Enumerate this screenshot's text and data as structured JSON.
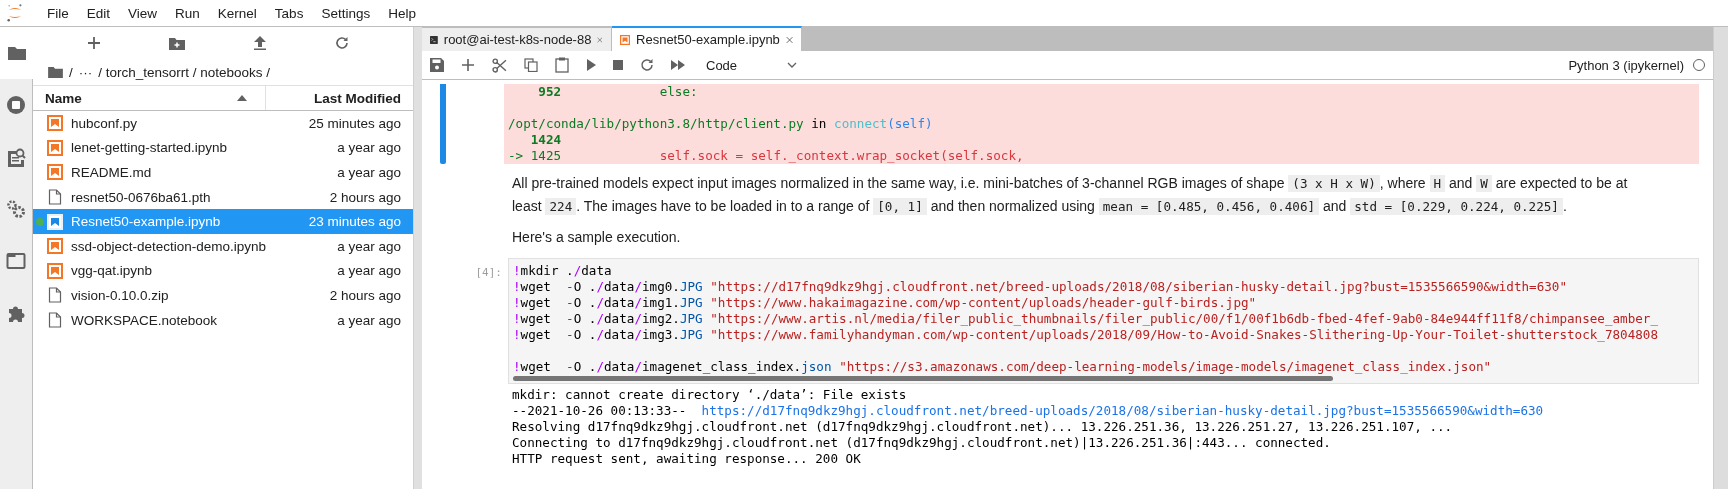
{
  "menu": [
    "File",
    "Edit",
    "View",
    "Run",
    "Kernel",
    "Tabs",
    "Settings",
    "Help"
  ],
  "file_browser": {
    "breadcrumb": [
      "/",
      "···",
      "/ torch_tensorrt / notebooks /"
    ],
    "columns": [
      {
        "label": "Name",
        "sorted": true
      },
      {
        "label": "Last Modified",
        "sorted": false
      }
    ],
    "files": [
      {
        "name": "hubconf.py",
        "modified": "25 minutes ago",
        "kind": "notebook",
        "selected": false,
        "running": false
      },
      {
        "name": "lenet-getting-started.ipynb",
        "modified": "a year ago",
        "kind": "notebook",
        "selected": false,
        "running": false
      },
      {
        "name": "README.md",
        "modified": "a year ago",
        "kind": "notebook",
        "selected": false,
        "running": false
      },
      {
        "name": "resnet50-0676ba61.pth",
        "modified": "2 hours ago",
        "kind": "file",
        "selected": false,
        "running": false
      },
      {
        "name": "Resnet50-example.ipynb",
        "modified": "23 minutes ago",
        "kind": "notebook",
        "selected": true,
        "running": true
      },
      {
        "name": "ssd-object-detection-demo.ipynb",
        "modified": "a year ago",
        "kind": "notebook",
        "selected": false,
        "running": false
      },
      {
        "name": "vgg-qat.ipynb",
        "modified": "a year ago",
        "kind": "notebook",
        "selected": false,
        "running": false
      },
      {
        "name": "vision-0.10.0.zip",
        "modified": "2 hours ago",
        "kind": "file",
        "selected": false,
        "running": false
      },
      {
        "name": "WORKSPACE.notebook",
        "modified": "a year ago",
        "kind": "file",
        "selected": false,
        "running": false
      }
    ]
  },
  "tabs": [
    {
      "label": "root@ai-test-k8s-node-88",
      "kind": "terminal",
      "selected": false
    },
    {
      "label": "Resnet50-example.ipynb",
      "kind": "notebook",
      "selected": true
    }
  ],
  "toolbar": {
    "cell_type": "Code",
    "kernel": "Python 3 (ipykernel)"
  },
  "traceback": [
    [
      [
        {
          "t": "    952",
          "kind": "num"
        },
        {
          "t": "             else:",
          "kind": "green"
        }
      ]
    ],
    [
      [
        {
          "t": "/opt/conda/lib/python3.8/http/client.py",
          "kind": "green"
        },
        {
          "t": " in ",
          "kind": "text"
        },
        {
          "t": "connect",
          "kind": "cyan"
        },
        {
          "t": "(self)",
          "kind": "blue"
        }
      ],
      [
        {
          "t": "   1424",
          "kind": "num"
        }
      ],
      [
        {
          "t": "-> 1425",
          "kind": "green"
        },
        {
          "t": "             self.sock = self._context.wrap_socket(self.sock,",
          "kind": "red"
        }
      ]
    ]
  ],
  "markdown": [
    [
      {
        "t": "All pre-trained models expect input images normalized in the same way, i.e. mini-batches of 3-channel RGB images of shape ",
        "code": false
      },
      {
        "t": "(3 x H x W)",
        "code": true
      },
      {
        "t": ", where ",
        "code": false
      },
      {
        "t": "H",
        "code": true
      },
      {
        "t": " and ",
        "code": false
      },
      {
        "t": "W",
        "code": true
      },
      {
        "t": " are expected to be at least ",
        "code": false
      },
      {
        "t": "224",
        "code": true
      },
      {
        "t": ". The images have to be loaded in to a range of ",
        "code": false
      },
      {
        "t": "[0, 1]",
        "code": true
      },
      {
        "t": " and then normalized using ",
        "code": false
      },
      {
        "t": "mean = [0.485, 0.456, 0.406]",
        "code": true
      },
      {
        "t": " and ",
        "code": false
      },
      {
        "t": "std = [0.229, 0.224, 0.225]",
        "code": true
      },
      {
        "t": ".",
        "code": false
      }
    ],
    [
      {
        "t": "Here's a sample execution.",
        "code": false
      }
    ]
  ],
  "code_cell": {
    "prompt": "[4]:",
    "blocks": [
      [
        [
          {
            "t": "!",
            "kind": "magic"
          },
          {
            "t": "mkdir .",
            "kind": "text"
          },
          {
            "t": "/",
            "kind": "op"
          },
          {
            "t": "data",
            "kind": "text"
          }
        ],
        [
          {
            "t": "!",
            "kind": "magic"
          },
          {
            "t": "wget  ",
            "kind": "text"
          },
          {
            "t": "-",
            "kind": "op"
          },
          {
            "t": "O .",
            "kind": "text"
          },
          {
            "t": "/",
            "kind": "op"
          },
          {
            "t": "data",
            "kind": "text"
          },
          {
            "t": "/",
            "kind": "op"
          },
          {
            "t": "img0.",
            "kind": "text"
          },
          {
            "t": "JPG",
            "kind": "attr"
          },
          {
            "t": " \"https://d17fnq9dkz9hgj.cloudfront.net/breed-uploads/2018/08/siberian-husky-detail.jpg?bust=1535566590&width=630\"",
            "kind": "str"
          }
        ],
        [
          {
            "t": "!",
            "kind": "magic"
          },
          {
            "t": "wget  ",
            "kind": "text"
          },
          {
            "t": "-",
            "kind": "op"
          },
          {
            "t": "O .",
            "kind": "text"
          },
          {
            "t": "/",
            "kind": "op"
          },
          {
            "t": "data",
            "kind": "text"
          },
          {
            "t": "/",
            "kind": "op"
          },
          {
            "t": "img1.",
            "kind": "text"
          },
          {
            "t": "JPG",
            "kind": "attr"
          },
          {
            "t": " \"https://www.hakaimagazine.com/wp-content/uploads/header-gulf-birds.jpg\"",
            "kind": "str"
          }
        ],
        [
          {
            "t": "!",
            "kind": "magic"
          },
          {
            "t": "wget  ",
            "kind": "text"
          },
          {
            "t": "-",
            "kind": "op"
          },
          {
            "t": "O .",
            "kind": "text"
          },
          {
            "t": "/",
            "kind": "op"
          },
          {
            "t": "data",
            "kind": "text"
          },
          {
            "t": "/",
            "kind": "op"
          },
          {
            "t": "img2.",
            "kind": "text"
          },
          {
            "t": "JPG",
            "kind": "attr"
          },
          {
            "t": " \"https://www.artis.nl/media/filer_public_thumbnails/filer_public/00/f1/00f1b6db-fbed-4fef-9ab0-84e944ff11f8/chimpansee_amber_",
            "kind": "str"
          }
        ],
        [
          {
            "t": "!",
            "kind": "magic"
          },
          {
            "t": "wget  ",
            "kind": "text"
          },
          {
            "t": "-",
            "kind": "op"
          },
          {
            "t": "O .",
            "kind": "text"
          },
          {
            "t": "/",
            "kind": "op"
          },
          {
            "t": "data",
            "kind": "text"
          },
          {
            "t": "/",
            "kind": "op"
          },
          {
            "t": "img3.",
            "kind": "text"
          },
          {
            "t": "JPG",
            "kind": "attr"
          },
          {
            "t": " \"https://www.familyhandyman.com/wp-content/uploads/2018/09/How-to-Avoid-Snakes-Slithering-Up-Your-Toilet-shutterstock_7804808",
            "kind": "str"
          }
        ]
      ],
      [
        [
          {
            "t": "!",
            "kind": "magic"
          },
          {
            "t": "wget  ",
            "kind": "text"
          },
          {
            "t": "-",
            "kind": "op"
          },
          {
            "t": "O .",
            "kind": "text"
          },
          {
            "t": "/",
            "kind": "op"
          },
          {
            "t": "data",
            "kind": "text"
          },
          {
            "t": "/",
            "kind": "op"
          },
          {
            "t": "imagenet_class_index.",
            "kind": "text"
          },
          {
            "t": "json",
            "kind": "attr"
          },
          {
            "t": " \"https://s3.amazonaws.com/deep-learning-models/image-models/imagenet_class_index.json\"",
            "kind": "str"
          }
        ]
      ]
    ]
  },
  "output": [
    [
      {
        "t": "mkdir: cannot create directory ‘./data’: File exists",
        "kind": "text"
      }
    ],
    [
      {
        "t": "--2021-10-26 00:13:33--  ",
        "kind": "text"
      },
      {
        "t": "https://d17fnq9dkz9hgj.cloudfront.net/breed-uploads/2018/08/siberian-husky-detail.jpg?bust=1535566590&width=630",
        "kind": "link"
      }
    ],
    [
      {
        "t": "Resolving d17fnq9dkz9hgj.cloudfront.net (d17fnq9dkz9hgj.cloudfront.net)... 13.226.251.36, 13.226.251.27, 13.226.251.107, ...",
        "kind": "text"
      }
    ],
    [
      {
        "t": "Connecting to d17fnq9dkz9hgj.cloudfront.net (d17fnq9dkz9hgj.cloudfront.net)|13.226.251.36|:443... connected.",
        "kind": "text"
      }
    ],
    [
      {
        "t": "HTTP request sent, awaiting response... 200 OK",
        "kind": "text"
      }
    ]
  ]
}
